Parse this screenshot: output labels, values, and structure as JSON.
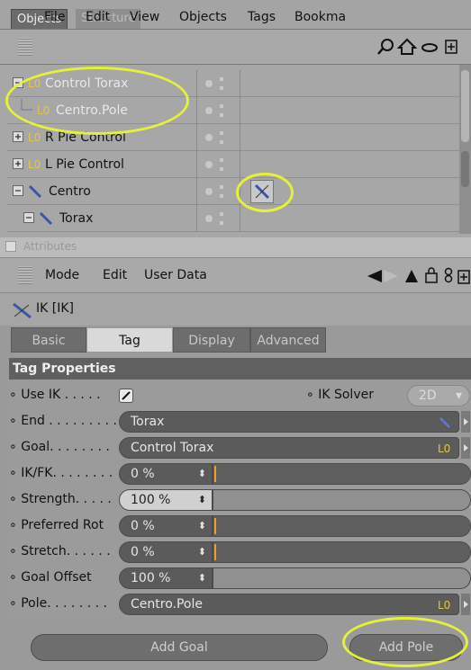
{
  "tabs": {
    "active": "Objects",
    "inactive": "Structure"
  },
  "menu": [
    "File",
    "Edit",
    "View",
    "Objects",
    "Tags",
    "Bookma"
  ],
  "objects": [
    {
      "name": "Control Torax"
    },
    {
      "name": "Centro.Pole"
    },
    {
      "name": "R Pie Control"
    },
    {
      "name": "L Pie Control"
    },
    {
      "name": "Centro"
    },
    {
      "name": "Torax"
    }
  ],
  "attributes": {
    "title": "Attributes",
    "menu": [
      "Mode",
      "Edit",
      "User Data"
    ]
  },
  "tag": {
    "name": "IK [IK]",
    "tabs": [
      "Basic",
      "Tag",
      "Display",
      "Advanced"
    ],
    "selected_tab": "Tag"
  },
  "section": "Tag Properties",
  "props": {
    "use_ik": "Use IK . . . . .",
    "ik_solver_label": "IK Solver",
    "ik_solver_value": "2D",
    "end_label": "End . . . . . . . . .",
    "end_value": "Torax",
    "goal_label": "Goal. . . . . . . .",
    "goal_value": "Control Torax",
    "ikfk_label": "IK/FK. . . . . . . .",
    "ikfk_value": "0 %",
    "strength_label": "Strength. . . . .",
    "strength_value": "100 %",
    "preferred_label": "Preferred Rot",
    "preferred_value": "0 %",
    "stretch_label": "Stretch. . . . . .",
    "stretch_value": "0 %",
    "goaloffset_label": "Goal Offset",
    "goaloffset_value": "100 %",
    "pole_label": "Pole. . . . . . . .",
    "pole_value": "Centro.Pole"
  },
  "buttons": {
    "add_goal": "Add Goal",
    "add_pole": "Add Pole"
  },
  "colors": {
    "highlight": "#e6f03a",
    "slider_marker": "#f0a020"
  }
}
